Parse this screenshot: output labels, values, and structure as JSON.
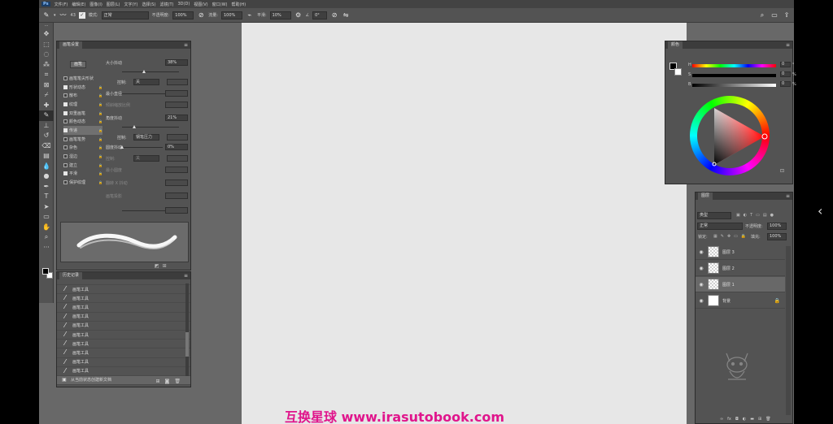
{
  "menubar": {
    "app_badge": "Ps",
    "items": [
      "文件(F)",
      "编辑(E)",
      "图像(I)",
      "图层(L)",
      "文字(Y)",
      "选择(S)",
      "滤镜(T)",
      "3D(D)",
      "视图(V)",
      "窗口(W)",
      "帮助(H)"
    ]
  },
  "options": {
    "brush_size": "43",
    "mode_label": "模式:",
    "mode_value": "正常",
    "opacity_label": "不透明度:",
    "opacity_value": "100%",
    "flow_label": "流量:",
    "flow_value": "100%",
    "smooth_label": "平滑:",
    "smooth_value": "10%",
    "angle_value": "0°"
  },
  "brush_settings": {
    "tab": "画笔设置",
    "brush_button": "画笔",
    "list": [
      {
        "label": "画笔笔尖形状",
        "checked": false
      },
      {
        "label": "形状动态",
        "checked": true
      },
      {
        "label": "散布",
        "checked": false
      },
      {
        "label": "纹理",
        "checked": true
      },
      {
        "label": "双重画笔",
        "checked": true
      },
      {
        "label": "颜色动态",
        "checked": false
      },
      {
        "label": "传递",
        "checked": true
      },
      {
        "label": "画笔笔势",
        "checked": false
      },
      {
        "label": "杂色",
        "checked": false
      },
      {
        "label": "湿边",
        "checked": false
      },
      {
        "label": "建立",
        "checked": false
      },
      {
        "label": "平滑",
        "checked": true
      },
      {
        "label": "保护纹理",
        "checked": false
      }
    ],
    "params": [
      {
        "label": "大小抖动",
        "value": "38%",
        "knob": 0.38,
        "dim": false
      },
      {
        "label": "控制:",
        "value": "关",
        "dim": false
      },
      {
        "label": "最小直径",
        "value": "",
        "dim": false
      },
      {
        "label": "倾斜缩放比例",
        "value": "",
        "dim": true
      },
      {
        "label": "角度抖动",
        "value": "21%",
        "knob": 0.21,
        "dim": false
      },
      {
        "label": "控制:",
        "value": "钢笔压力",
        "dim": false
      },
      {
        "label": "圆度抖动",
        "value": "0%",
        "knob": 0.0,
        "dim": false
      },
      {
        "label": "控制:",
        "value": "关",
        "dim": true
      },
      {
        "label": "最小圆度",
        "value": "",
        "dim": true
      },
      {
        "label": "翻转 X 抖动",
        "value": "",
        "dim": true
      },
      {
        "label": "画笔投影",
        "value": "",
        "dim": true
      }
    ]
  },
  "history": {
    "tab": "历史记录",
    "items": [
      "画笔工具",
      "画笔工具",
      "画笔工具",
      "画笔工具",
      "画笔工具",
      "画笔工具",
      "画笔工具",
      "画笔工具",
      "画笔工具",
      "画笔工具"
    ],
    "snapshot": "从当前状态创建新文档"
  },
  "color": {
    "tab": "颜色",
    "channels": [
      {
        "label": "H",
        "value": "0",
        "unit": "°"
      },
      {
        "label": "S",
        "value": "0",
        "unit": "%"
      },
      {
        "label": "B",
        "value": "0",
        "unit": "%"
      }
    ]
  },
  "layers": {
    "tab": "图层",
    "kind": "类型",
    "blend": "正常",
    "opacity_label": "不透明度:",
    "opacity_value": "100%",
    "lock_label": "锁定:",
    "fill_label": "填充:",
    "fill_value": "100%",
    "rows": [
      {
        "name": "图层 3",
        "selected": false,
        "white": false,
        "locked": false
      },
      {
        "name": "图层 2",
        "selected": false,
        "white": false,
        "locked": false
      },
      {
        "name": "图层 1",
        "selected": true,
        "white": false,
        "locked": false
      },
      {
        "name": "背景",
        "selected": false,
        "white": true,
        "locked": true
      }
    ]
  },
  "watermark": "互换星球 www.irasutobook.com"
}
